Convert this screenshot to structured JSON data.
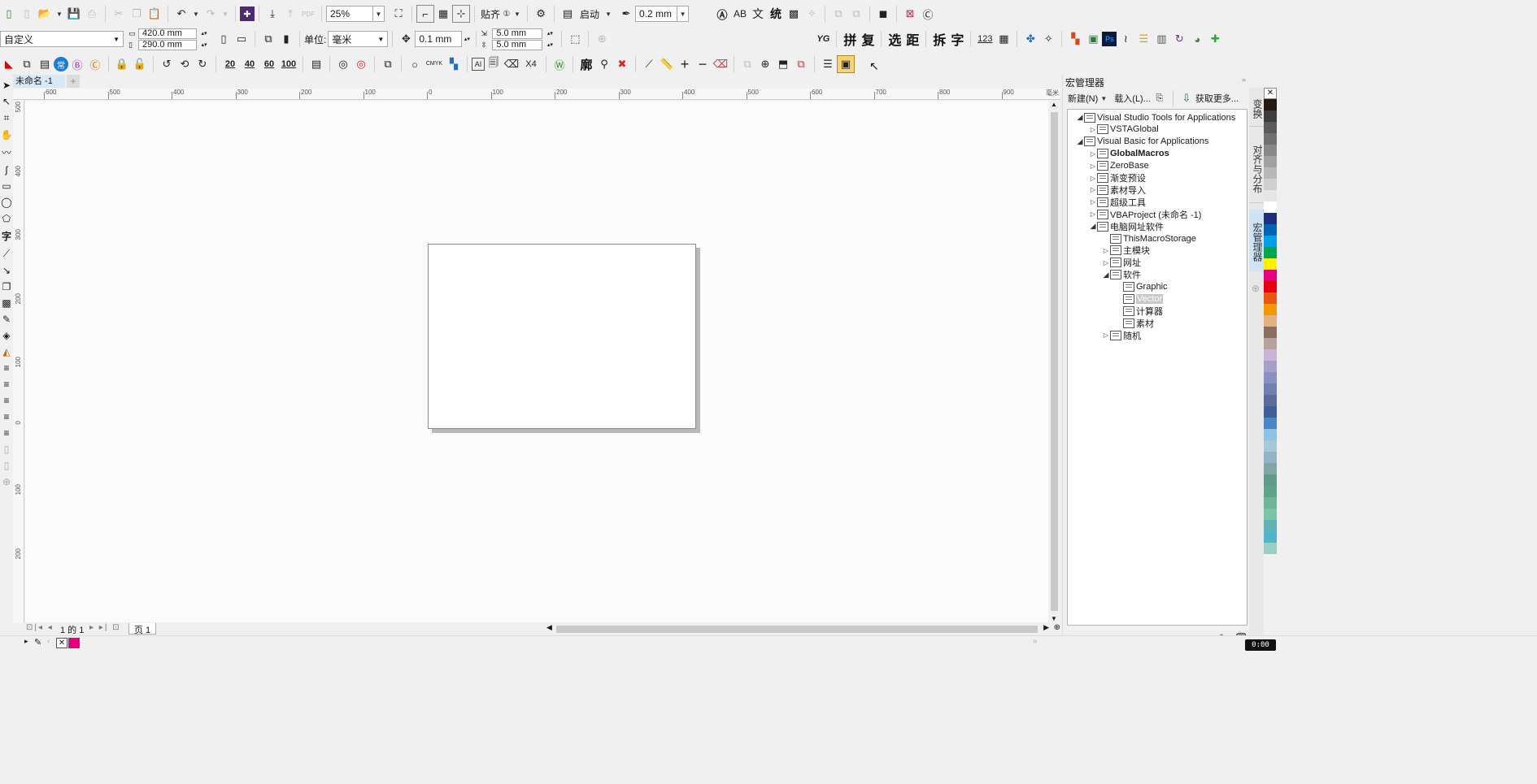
{
  "toolbar1": {
    "zoom_value": "25%",
    "snap_label": "贴齐",
    "launch_label": "启动",
    "outline_value": "0.2 mm",
    "cjk_btns": [
      "AB",
      "文",
      "统"
    ]
  },
  "toolbar2": {
    "preset_value": "自定义",
    "width_value": "420.0 mm",
    "height_value": "290.0 mm",
    "units_label": "单位:",
    "units_value": "毫米",
    "nudge_value": "0.1 mm",
    "dup_x_value": "5.0 mm",
    "dup_y_value": "5.0 mm",
    "right_btns": [
      "拼",
      "复",
      "选",
      "距",
      "拆",
      "字"
    ],
    "num_btn": "123"
  },
  "toolbar3": {
    "num_btns": [
      "20",
      "40",
      "60",
      "100"
    ],
    "cmyk": "CMYK",
    "x4": "X4",
    "kuo": "廓"
  },
  "document": {
    "tab_title": "未命名 -1",
    "h_ruler_labels": [
      "600",
      "500",
      "400",
      "300",
      "200",
      "100",
      "0",
      "100",
      "200",
      "300",
      "400",
      "500",
      "600",
      "700",
      "800",
      "900"
    ],
    "unit_label": "毫米",
    "v_ruler_labels": [
      "500",
      "400",
      "300",
      "200",
      "100",
      "0",
      "100",
      "200"
    ],
    "page_nav": "1 的 1",
    "page_tab": "页 1"
  },
  "macro_panel": {
    "title": "宏管理器",
    "new_label": "新建(N)",
    "load_label": "载入(L)...",
    "get_more_label": "获取更多...",
    "tree": [
      {
        "label": "Visual Studio Tools for Applications",
        "level": 0,
        "expanded": true,
        "bold": false,
        "selected": false
      },
      {
        "label": "VSTAGlobal",
        "level": 1,
        "expanded": false,
        "bold": false,
        "selected": false
      },
      {
        "label": "Visual Basic for Applications",
        "level": 0,
        "expanded": true,
        "bold": false,
        "selected": false
      },
      {
        "label": "GlobalMacros",
        "level": 1,
        "expanded": false,
        "bold": true,
        "selected": false
      },
      {
        "label": "ZeroBase",
        "level": 1,
        "expanded": false,
        "bold": false,
        "selected": false
      },
      {
        "label": "渐变预设",
        "level": 1,
        "expanded": false,
        "bold": false,
        "selected": false
      },
      {
        "label": "素材导入",
        "level": 1,
        "expanded": false,
        "bold": false,
        "selected": false
      },
      {
        "label": "超级工具",
        "level": 1,
        "expanded": false,
        "bold": false,
        "selected": false
      },
      {
        "label": "VBAProject (未命名 -1)",
        "level": 1,
        "expanded": false,
        "bold": false,
        "selected": false
      },
      {
        "label": "电脑网址软件",
        "level": 1,
        "expanded": true,
        "bold": false,
        "selected": false
      },
      {
        "label": "ThisMacroStorage",
        "level": 2,
        "leaf": true,
        "bold": false,
        "selected": false
      },
      {
        "label": "主模块",
        "level": 2,
        "expanded": false,
        "bold": false,
        "selected": false
      },
      {
        "label": "网址",
        "level": 2,
        "expanded": false,
        "bold": false,
        "selected": false
      },
      {
        "label": "软件",
        "level": 2,
        "expanded": true,
        "bold": false,
        "selected": false
      },
      {
        "label": "Graphic",
        "level": 3,
        "leaf": true,
        "bold": false,
        "selected": false
      },
      {
        "label": "Vector",
        "level": 3,
        "leaf": true,
        "bold": false,
        "selected": true
      },
      {
        "label": "计算器",
        "level": 3,
        "leaf": true,
        "bold": false,
        "selected": false
      },
      {
        "label": "素材",
        "level": 3,
        "leaf": true,
        "bold": false,
        "selected": false
      },
      {
        "label": "随机",
        "level": 2,
        "expanded": false,
        "bold": false,
        "selected": false
      }
    ]
  },
  "side_tabs": [
    "变换",
    "对齐与分布",
    "宏管理器"
  ],
  "palette": [
    "#231815",
    "#3d3d3d",
    "#5a5a5a",
    "#707070",
    "#888888",
    "#a0a0a0",
    "#b8b8b8",
    "#cfcfcf",
    "#e6e6e6",
    "#ffffff",
    "#1d2f7a",
    "#0066b3",
    "#00a0e9",
    "#00a650",
    "#fff100",
    "#e4007f",
    "#e60012",
    "#ea5514",
    "#f39800",
    "#e3b27e",
    "#8c6d62",
    "#b7a29a",
    "#c9b3d6",
    "#a6a0c9",
    "#8a8fc4",
    "#7180ad",
    "#5b6c9a",
    "#3f5f97",
    "#4a86c5",
    "#8fc3e6",
    "#a8c7d8",
    "#93b3c9",
    "#7fa7a5",
    "#5f9b8c",
    "#5fa38a",
    "#6fb59a",
    "#7cc4a8",
    "#61b2b5",
    "#4fb5c9",
    "#9ad0c4"
  ],
  "status": {
    "time": "0:00"
  }
}
